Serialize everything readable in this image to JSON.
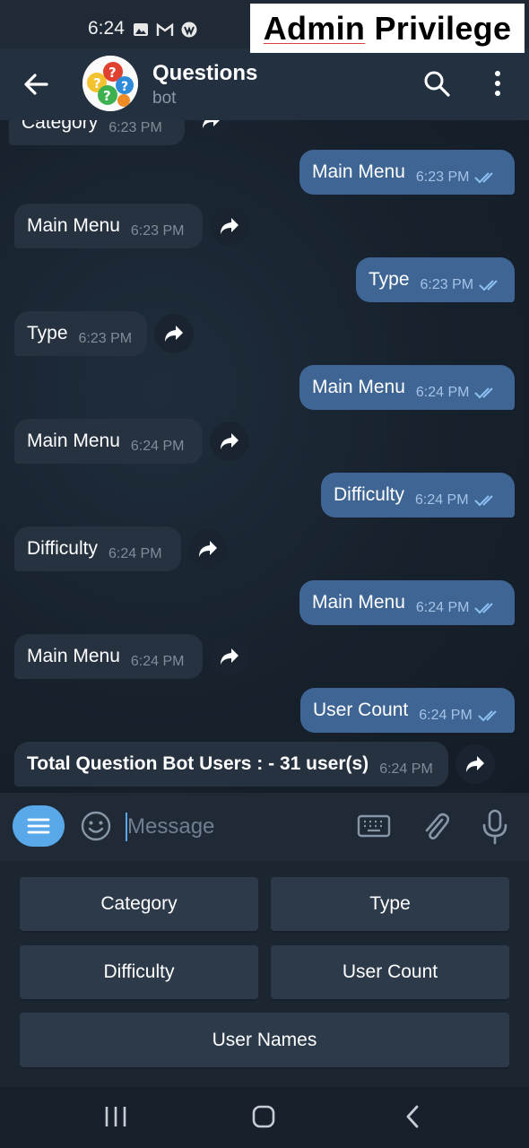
{
  "status_bar": {
    "time": "6:24"
  },
  "banner": {
    "word1": "Admin",
    "word2": "Privilege"
  },
  "header": {
    "title": "Questions",
    "subtitle": "bot"
  },
  "chat": {
    "partial": {
      "text": "Category",
      "time": "6:23 PM"
    },
    "messages": [
      {
        "dir": "out",
        "text": "Main Menu",
        "time": "6:23 PM"
      },
      {
        "dir": "in",
        "text": "Main Menu",
        "time": "6:23 PM"
      },
      {
        "dir": "out",
        "text": "Type",
        "time": "6:23 PM"
      },
      {
        "dir": "in",
        "text": "Type",
        "time": "6:23 PM"
      },
      {
        "dir": "out",
        "text": "Main Menu",
        "time": "6:24 PM"
      },
      {
        "dir": "in",
        "text": "Main Menu",
        "time": "6:24 PM"
      },
      {
        "dir": "out",
        "text": "Difficulty",
        "time": "6:24 PM"
      },
      {
        "dir": "in",
        "text": "Difficulty",
        "time": "6:24 PM"
      },
      {
        "dir": "out",
        "text": "Main Menu",
        "time": "6:24 PM"
      },
      {
        "dir": "in",
        "text": "Main Menu",
        "time": "6:24 PM"
      },
      {
        "dir": "out",
        "text": "User Count",
        "time": "6:24 PM"
      },
      {
        "dir": "in",
        "text": "Total Question Bot Users : - 31 user(s)",
        "time": "6:24 PM"
      }
    ]
  },
  "composer": {
    "placeholder": "Message"
  },
  "keyboard": {
    "buttons": [
      "Category",
      "Type",
      "Difficulty",
      "User Count",
      "User Names"
    ]
  },
  "colors": {
    "outgoing_bubble": "#3e6594",
    "incoming_bubble": "#26323f",
    "accent": "#59a8e9"
  }
}
